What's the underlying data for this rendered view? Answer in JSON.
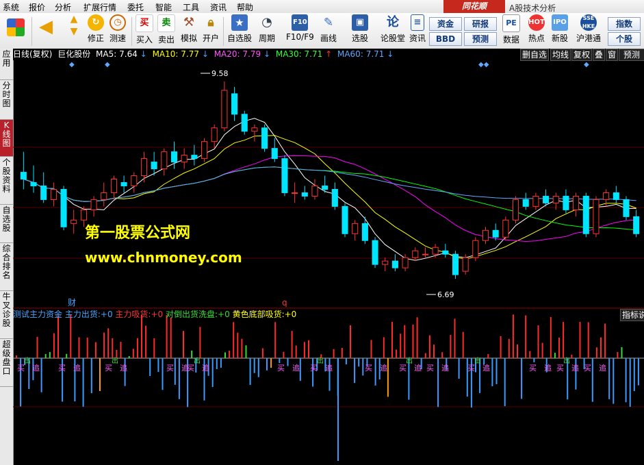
{
  "menu": {
    "items": [
      "系统",
      "报价",
      "分析",
      "扩展行情",
      "委托",
      "智能",
      "工具",
      "资讯",
      "帮助"
    ],
    "brand": "同花顺",
    "app_title": "A股技术分析"
  },
  "toolbar": {
    "buttons": [
      {
        "label": "修正",
        "icon": "refresh-icon"
      },
      {
        "label": "测速",
        "icon": "clock-icon"
      },
      {
        "label": "买入",
        "icon": "buy-icon",
        "glyph": "买"
      },
      {
        "label": "卖出",
        "icon": "sell-icon",
        "glyph": "卖"
      },
      {
        "label": "模拟",
        "icon": "hammer-icon"
      },
      {
        "label": "开户",
        "icon": "lock-icon"
      },
      {
        "label": "自选股",
        "icon": "star-icon"
      },
      {
        "label": "周期",
        "icon": "clock-cycle-icon"
      },
      {
        "label": "F10/F9",
        "icon": "f10-icon"
      },
      {
        "label": "画线",
        "icon": "pencil-icon"
      },
      {
        "label": "选股",
        "icon": "monitor-icon"
      },
      {
        "label": "论股堂",
        "icon": "lun-icon",
        "glyph": "论"
      },
      {
        "label": "资讯",
        "icon": "document-icon"
      },
      {
        "label": "数据",
        "icon": "pe-icon",
        "glyph": "PE"
      },
      {
        "label": "热点",
        "icon": "hot-icon"
      },
      {
        "label": "新股",
        "icon": "new-stock-icon"
      },
      {
        "label": "沪港通",
        "icon": "hk-connect-icon"
      }
    ],
    "small_buttons": [
      "资金",
      "研报",
      "BBD",
      "预测",
      "指数",
      "个股"
    ]
  },
  "left_tabs": [
    "应用",
    "分时图",
    "K线图",
    "个股资料",
    "自选股",
    "综合排名",
    "牛叉诊股",
    "超级盘口"
  ],
  "active_left_tab": "K线图",
  "info": {
    "period": "日线(复权)",
    "stock_name": "巨化股份",
    "ma5_label": "MA5:",
    "ma5_value": "7.64",
    "ma10_label": "MA10:",
    "ma10_value": "7.77",
    "ma20_label": "MA20:",
    "ma20_value": "7.79",
    "ma30_label": "MA30:",
    "ma30_value": "7.71",
    "ma60_label": "MA60:",
    "ma60_value": "7.71",
    "arrow_down": "↓",
    "arrow_up": "↑"
  },
  "right_buttons": [
    "删自选",
    "均线",
    "复权",
    "叠",
    "窗",
    "预测"
  ],
  "chart": {
    "high_label": "9.58",
    "low_label": "6.69",
    "marker_cai": "财",
    "marker_q": "q"
  },
  "watermark": {
    "line1": "第一股票公式网",
    "line2": "www.chnmoney.com"
  },
  "indicator": {
    "title": "测试主力资金",
    "items": [
      {
        "label": "主力出货:",
        "value": "+0",
        "color": "#4aa3ff"
      },
      {
        "label": "主力吸货:",
        "value": "+0",
        "color": "#ff3030"
      },
      {
        "label": "对倒出货洗盘:",
        "value": "+0",
        "color": "#33dd33"
      },
      {
        "label": "黄色底部吸货:",
        "value": "+0",
        "color": "#ffff00"
      }
    ],
    "button": "指标说",
    "signal_buy": "买",
    "signal_chase": "追",
    "signal_out": "出"
  },
  "colors": {
    "up": "#ff3232",
    "down": "#00e5ff",
    "ma5": "#ffffff",
    "ma10": "#ffff00",
    "ma20": "#ff00ff",
    "ma30": "#00ff00",
    "ma60": "#5fa8ff",
    "brand_red": "#c6281d"
  },
  "chart_data": {
    "type": "candlestick",
    "title": "巨化股份 日线(复权)",
    "y_range": [
      6.4,
      9.85
    ],
    "candles": [
      [
        8.25,
        8.55,
        8.0,
        8.15
      ],
      [
        8.1,
        8.35,
        7.95,
        8.05
      ],
      [
        8.05,
        8.25,
        7.8,
        7.85
      ],
      [
        7.85,
        8.1,
        7.75,
        8.0
      ],
      [
        8.0,
        8.05,
        7.4,
        7.45
      ],
      [
        7.5,
        7.7,
        7.35,
        7.55
      ],
      [
        7.55,
        7.75,
        7.45,
        7.7
      ],
      [
        7.7,
        7.9,
        7.6,
        7.85
      ],
      [
        7.85,
        8.1,
        7.75,
        7.95
      ],
      [
        7.95,
        8.2,
        7.85,
        8.15
      ],
      [
        8.1,
        8.2,
        7.95,
        8.05
      ],
      [
        8.05,
        8.25,
        7.95,
        8.2
      ],
      [
        8.2,
        8.55,
        8.1,
        8.45
      ],
      [
        8.4,
        8.55,
        8.2,
        8.3
      ],
      [
        8.3,
        8.6,
        8.2,
        8.55
      ],
      [
        8.55,
        8.7,
        8.3,
        8.4
      ],
      [
        8.4,
        8.6,
        8.3,
        8.5
      ],
      [
        8.5,
        8.65,
        8.35,
        8.45
      ],
      [
        8.45,
        8.75,
        8.4,
        8.7
      ],
      [
        8.7,
        8.95,
        8.6,
        8.9
      ],
      [
        8.9,
        9.58,
        8.85,
        9.45
      ],
      [
        9.4,
        9.5,
        9.0,
        9.1
      ],
      [
        9.1,
        9.15,
        8.8,
        8.85
      ],
      [
        8.85,
        8.95,
        8.7,
        8.9
      ],
      [
        8.9,
        8.95,
        8.55,
        8.6
      ],
      [
        8.6,
        8.75,
        8.4,
        8.45
      ],
      [
        8.45,
        8.5,
        7.9,
        7.95
      ],
      [
        7.95,
        8.1,
        7.8,
        7.95
      ],
      [
        7.95,
        8.05,
        7.85,
        7.9
      ],
      [
        7.9,
        8.15,
        7.85,
        8.05
      ],
      [
        8.05,
        8.2,
        7.95,
        8.0
      ],
      [
        8.0,
        8.1,
        7.7,
        7.75
      ],
      [
        7.75,
        7.8,
        7.3,
        7.35
      ],
      [
        7.35,
        7.55,
        7.25,
        7.5
      ],
      [
        7.5,
        7.6,
        7.2,
        7.25
      ],
      [
        7.25,
        7.3,
        6.85,
        6.9
      ],
      [
        6.9,
        7.0,
        6.8,
        6.95
      ],
      [
        6.95,
        7.05,
        6.8,
        6.85
      ],
      [
        6.85,
        7.05,
        6.8,
        7.0
      ],
      [
        7.0,
        7.15,
        6.95,
        7.1
      ],
      [
        7.05,
        7.15,
        7.0,
        7.05
      ],
      [
        7.05,
        7.2,
        7.0,
        7.15
      ],
      [
        7.1,
        7.2,
        7.0,
        7.05
      ],
      [
        7.05,
        7.1,
        6.69,
        6.75
      ],
      [
        6.8,
        7.05,
        6.75,
        7.0
      ],
      [
        7.0,
        7.3,
        6.95,
        7.25
      ],
      [
        7.25,
        7.45,
        7.2,
        7.4
      ],
      [
        7.4,
        7.5,
        7.25,
        7.3
      ],
      [
        7.3,
        7.6,
        7.25,
        7.55
      ],
      [
        7.55,
        7.9,
        7.5,
        7.85
      ],
      [
        7.85,
        7.95,
        7.7,
        7.75
      ],
      [
        7.75,
        7.95,
        7.7,
        7.9
      ],
      [
        7.9,
        8.0,
        7.75,
        7.8
      ],
      [
        7.8,
        7.95,
        7.7,
        7.9
      ],
      [
        7.9,
        8.0,
        7.65,
        7.7
      ],
      [
        7.7,
        7.95,
        7.6,
        7.9
      ],
      [
        7.9,
        7.95,
        7.3,
        7.35
      ],
      [
        7.35,
        7.9,
        7.3,
        7.85
      ],
      [
        7.85,
        8.0,
        7.75,
        7.95
      ],
      [
        7.95,
        8.05,
        7.8,
        7.85
      ],
      [
        7.85,
        7.9,
        7.55,
        7.6
      ],
      [
        7.6,
        7.7,
        7.3,
        7.35
      ]
    ]
  }
}
